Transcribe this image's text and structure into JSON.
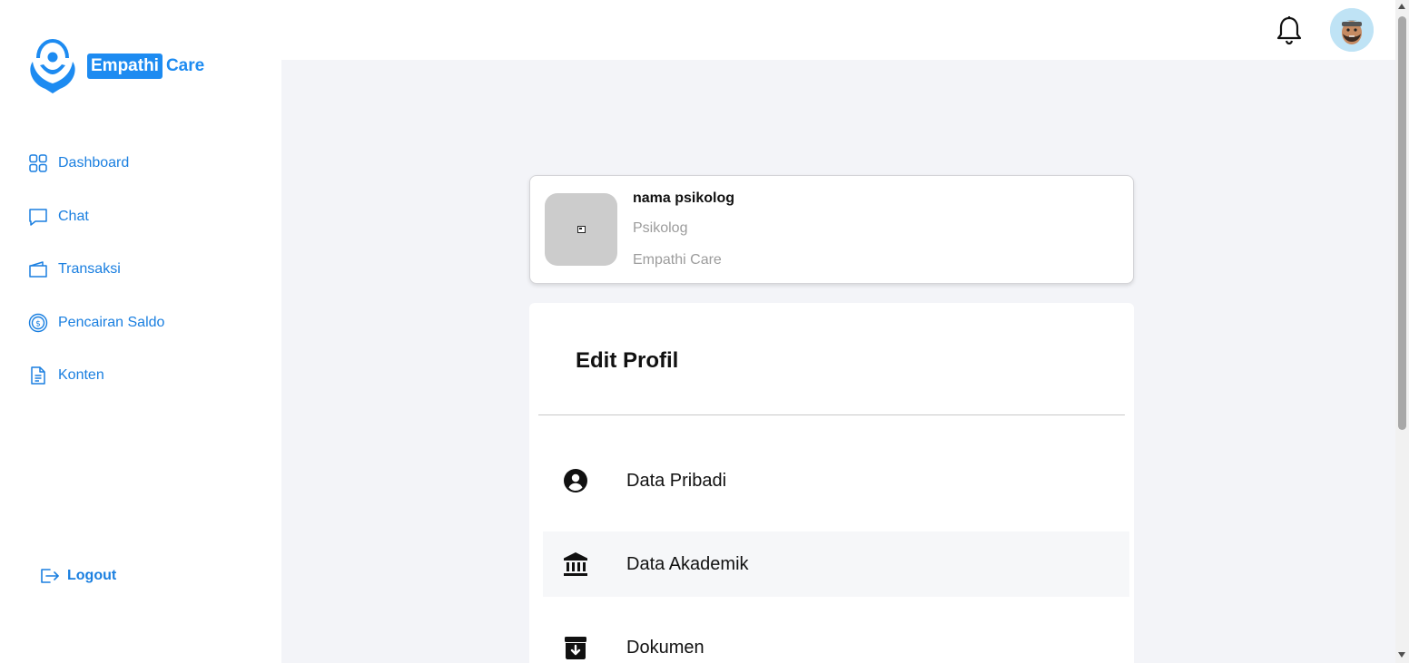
{
  "brand": {
    "name_part1": "Empathi",
    "name_part2": "Care",
    "color": "#1d8bf1"
  },
  "sidebar": {
    "items": [
      {
        "label": "Dashboard",
        "icon": "dashboard-grid-icon"
      },
      {
        "label": "Chat",
        "icon": "chat-bubble-icon"
      },
      {
        "label": "Transaksi",
        "icon": "wallet-icon"
      },
      {
        "label": "Pencairan Saldo",
        "icon": "dollar-coin-icon"
      },
      {
        "label": "Konten",
        "icon": "document-icon"
      }
    ],
    "logout_label": "Logout"
  },
  "topbar": {
    "notification_icon": "bell-icon",
    "avatar_icon": "user-avatar-icon"
  },
  "profile": {
    "name": "nama psikolog",
    "role": "Psikolog",
    "organization": "Empathi Care"
  },
  "edit_profile": {
    "title": "Edit Profil",
    "items": [
      {
        "label": "Data Pribadi",
        "icon": "user-circle-icon"
      },
      {
        "label": "Data Akademik",
        "icon": "institution-icon"
      },
      {
        "label": "Dokumen",
        "icon": "archive-box-icon"
      }
    ]
  },
  "colors": {
    "accent": "#1a7fe0",
    "main_bg": "#f3f4f8"
  }
}
